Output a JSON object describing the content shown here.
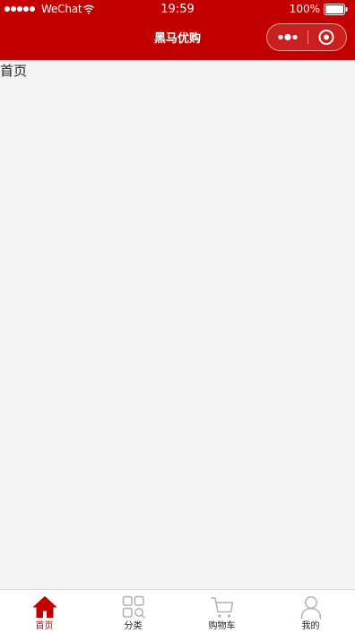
{
  "status_bar": {
    "carrier": "WeChat",
    "time": "19:59",
    "battery": "100%",
    "signal_bars": 5
  },
  "nav": {
    "title": "黑马优购",
    "icons": [
      "more-icon",
      "close-icon"
    ]
  },
  "page": {
    "text": "首页"
  },
  "tabs": [
    {
      "label": "首页",
      "icon": "home-icon",
      "active": true
    },
    {
      "label": "分类",
      "icon": "category-icon",
      "active": false
    },
    {
      "label": "购物车",
      "icon": "cart-icon",
      "active": false
    },
    {
      "label": "我的",
      "icon": "user-icon",
      "active": false
    }
  ],
  "colors": {
    "brand": "#c20000",
    "background": "#f4f4f5",
    "tab_inactive_icon": "#b6aeae"
  }
}
